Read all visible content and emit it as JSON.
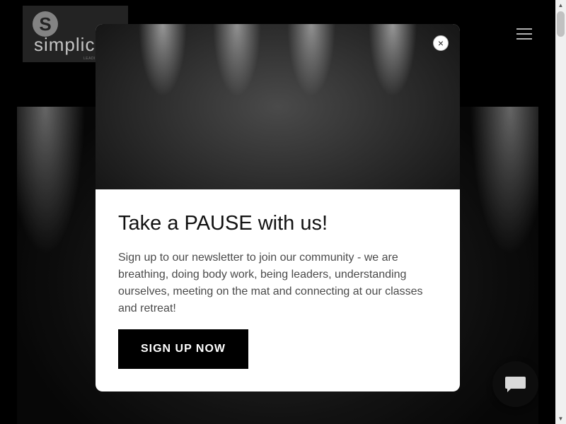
{
  "header": {
    "logo_text": "simplic",
    "logo_letter": "S",
    "logo_tagline": "LEADING W",
    "menu_icon": "hamburger-menu-icon"
  },
  "modal": {
    "title": "Take a PAUSE with us!",
    "body": "Sign up to our newsletter to join our community - we are breathing, doing body work, being leaders, understanding ourselves, meeting on the mat and connecting at our classes and retreat!",
    "signup_label": "SIGN UP NOW",
    "close_symbol": "×",
    "close_icon": "close-icon"
  },
  "chat": {
    "icon": "chat-bubble-icon"
  },
  "scrollbar": {
    "up_symbol": "▲",
    "down_symbol": "▼"
  },
  "colors": {
    "page_background": "#000000",
    "modal_background": "#ffffff",
    "button_background": "#000000",
    "button_text": "#ffffff"
  }
}
